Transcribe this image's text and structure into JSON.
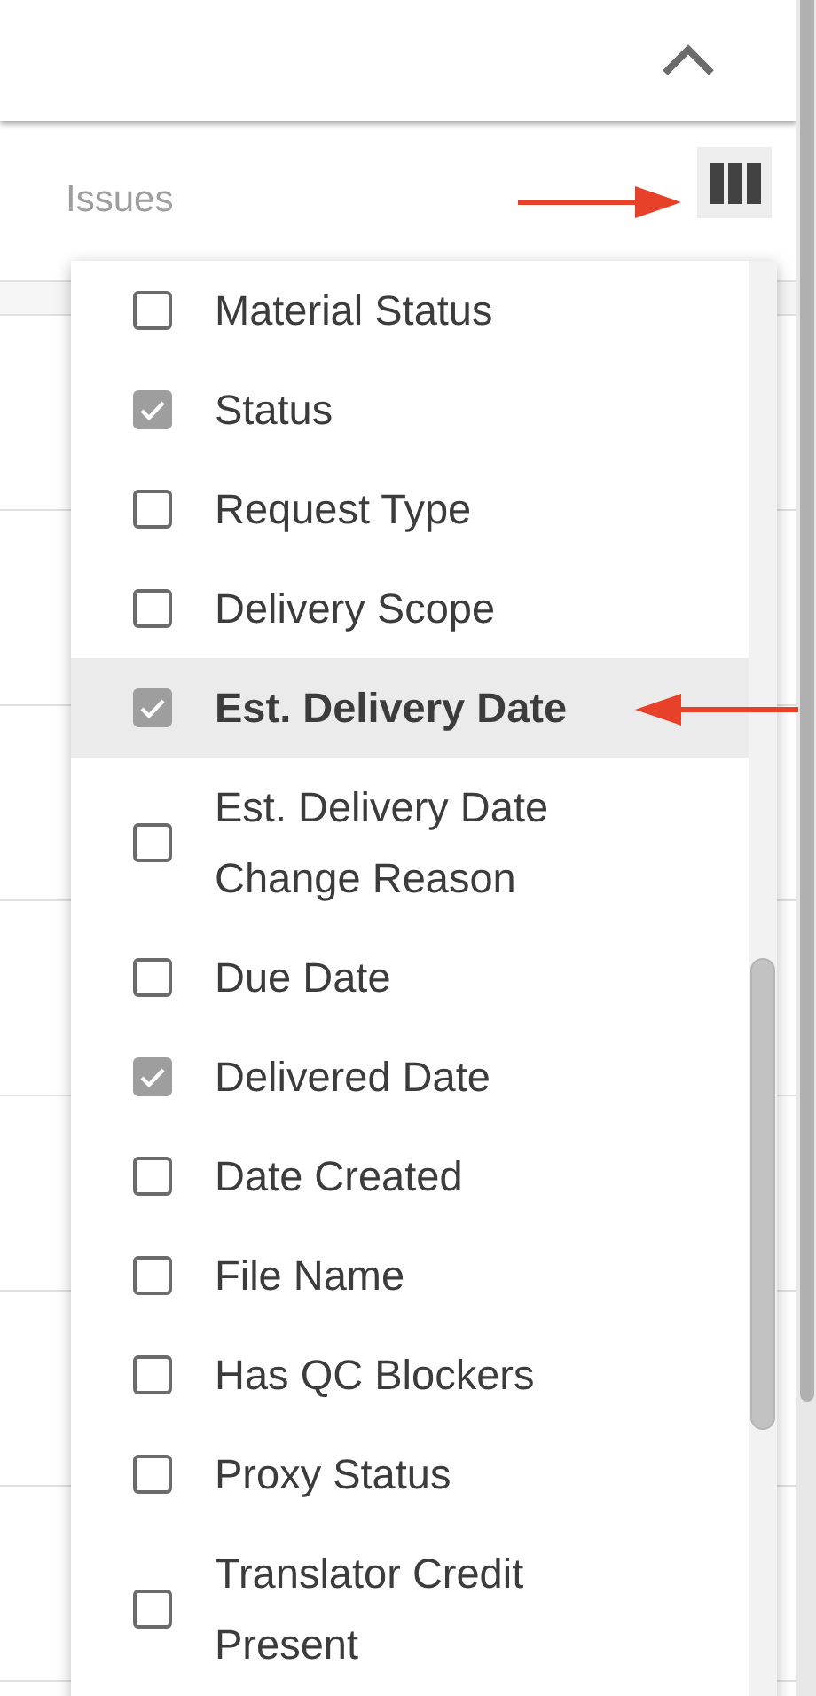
{
  "toolbar": {
    "title": "Issues"
  },
  "column_menu": {
    "items": [
      {
        "label": "Material Status",
        "checked": false,
        "selected": false
      },
      {
        "label": "Status",
        "checked": true,
        "selected": false
      },
      {
        "label": "Request Type",
        "checked": false,
        "selected": false
      },
      {
        "label": "Delivery Scope",
        "checked": false,
        "selected": false
      },
      {
        "label": "Est. Delivery Date",
        "checked": true,
        "selected": true
      },
      {
        "label": "Est. Delivery Date Change Reason",
        "checked": false,
        "selected": false
      },
      {
        "label": "Due Date",
        "checked": false,
        "selected": false
      },
      {
        "label": "Delivered Date",
        "checked": true,
        "selected": false
      },
      {
        "label": "Date Created",
        "checked": false,
        "selected": false
      },
      {
        "label": "File Name",
        "checked": false,
        "selected": false
      },
      {
        "label": "Has QC Blockers",
        "checked": false,
        "selected": false
      },
      {
        "label": "Proxy Status",
        "checked": false,
        "selected": false
      },
      {
        "label": "Translator Credit Present",
        "checked": false,
        "selected": false
      }
    ]
  }
}
